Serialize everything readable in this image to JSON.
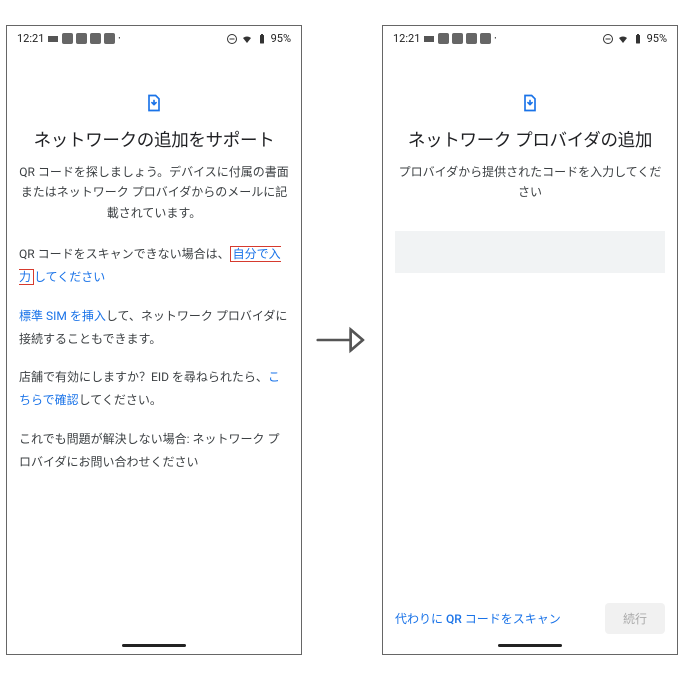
{
  "status": {
    "time": "12:21",
    "battery": "95%"
  },
  "left_screen": {
    "title": "ネットワークの追加をサポート",
    "subtitle": "QR コードを探しましょう。デバイスに付属の書面またはネットワーク プロバイダからのメールに記載されています。",
    "p1_before": "QR コードをスキャンできない場合は、",
    "p1_link": "自分で入力",
    "p1_after": "してください",
    "p2_link": "標準 SIM を挿入",
    "p2_after": "して、ネットワーク プロバイダに接続することもできます。",
    "p3_before": "店舗で有効にしますか？EID を尋ねられたら、",
    "p3_link": "こちらで確認",
    "p3_after": "してください。",
    "p4": "これでも問題が解決しない場合: ネットワーク プロバイダにお問い合わせください"
  },
  "right_screen": {
    "title": "ネットワーク プロバイダの追加",
    "subtitle": "プロバイダから提供されたコードを入力してください",
    "alt_link": "代わりに QR コードをスキャン",
    "continue_btn": "続行"
  }
}
